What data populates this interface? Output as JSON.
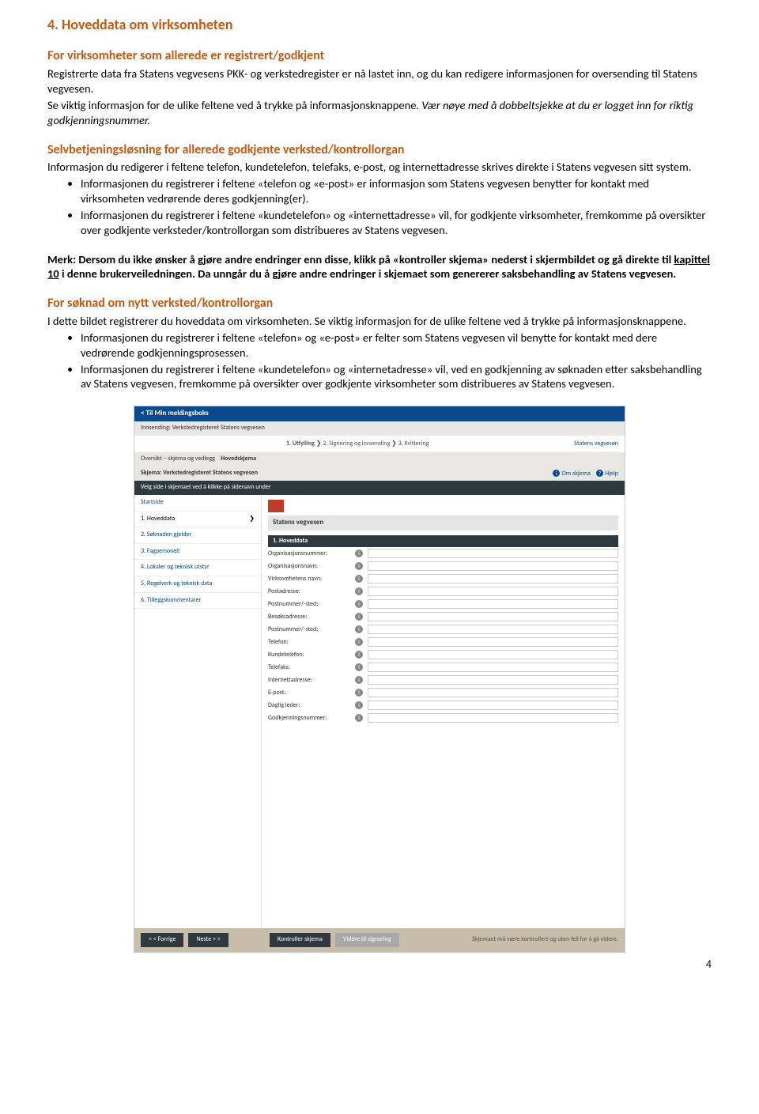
{
  "doc": {
    "h1": "4. Hoveddata om virksomheten",
    "s1": {
      "title": "For virksomheter som allerede er registrert/godkjent",
      "p1": "Registrerte data fra Statens vegvesens PKK- og verkstedregister er nå lastet inn, og du kan redigere informasjonen for oversending til Statens vegvesen.",
      "p2a": "Se viktig informasjon for de ulike feltene ved å trykke på informasjonsknappene. ",
      "p2b": "Vær nøye med å dobbeltsjekke at du er logget inn for riktig godkjenningsnummer."
    },
    "s2": {
      "title": "Selvbetjeningsløsning for allerede godkjente verksted/kontrollorgan",
      "p1": "Informasjon du redigerer i feltene telefon, kundetelefon, telefaks, e-post, og internettadresse skrives direkte i Statens vegvesen sitt system.",
      "b1": "Informasjonen du registrerer i feltene «telefon og «e-post» er informasjon som Statens vegvesen benytter for kontakt med virksomheten vedrørende deres godkjenning(er).",
      "b2": "Informasjonen du registrerer i feltene «kundetelefon» og «internettadresse» vil, for godkjente virksomheter, fremkomme på oversikter over godkjente verksteder/kontrollorgan som distribueres av Statens vegvesen."
    },
    "note": {
      "a": "Merk: Dersom du ikke ønsker å gjøre andre endringer enn disse, klikk på «kontroller skjema» nederst i skjermbildet og gå direkte til ",
      "link": "kapittel 10",
      "b": " i denne brukerveiledningen. Da unngår du å gjøre andre endringer i skjemaet som genererer saksbehandling av Statens vegvesen."
    },
    "s3": {
      "title": "For søknad om nytt verksted/kontrollorgan",
      "p1": "I dette bildet registrerer du hoveddata om virksomheten. Se viktig informasjon for de ulike feltene ved å trykke på informasjonsknappene.",
      "b1": "Informasjonen du registrerer i feltene «telefon» og «e-post» er felter som Statens vegvesen vil benytte for kontakt med dere vedrørende godkjenningsprosessen.",
      "b2": "Informasjonen du registrerer i feltene «kundetelefon» og «internetadresse» vil, ved en godkjenning av søknaden etter saksbehandling av Statens vegvesen, fremkomme på oversikter over godkjente virksomheter som distribueres av Statens vegvesen."
    },
    "page": "4"
  },
  "shot": {
    "backlink": "< Til Min meldingsboks",
    "innsending": "Innsending: Verkstedregisteret Statens vegvesen",
    "brand_right": "Statens vegvesen",
    "steps": {
      "s1": "1. Utfylling",
      "s2": "2. Signering og innsending",
      "s3": "3. Kvittering"
    },
    "tabs": {
      "oversikt": "Oversikt – skjema og vedlegg",
      "hoved": "Hovedskjema"
    },
    "skjema_label": "Skjema: Verkstedregisteret Statens vegvesen",
    "om_skjema": "Om skjema",
    "hjelp": "Hjelp",
    "help_hint": "Velg side i skjemaet ved å klikke på sidenavn under",
    "side": {
      "start": "Startside",
      "i1": "1. Hoveddata",
      "i2": "2. Søknaden gjelder",
      "i3": "3. Fagpersonell",
      "i4": "4. Lokaler og teknisk utstyr",
      "i5": "5. Regelverk og teknisk data",
      "i6": "6. Tilleggskommentarer"
    },
    "main_brand": "Statens vegvesen",
    "section_title": "1. Hoveddata",
    "fields": [
      "Organisasjonsnummer:",
      "Organisasjonsnavn:",
      "Virksomhetens navn:",
      "Postadresse:",
      "Postnummer/-sted:",
      "Besøksadresse:",
      "Postnummer/-sted:",
      "Telefon:",
      "Kundetelefon:",
      "Telefaks:",
      "Internettadresse:",
      "E-post:",
      "Daglig leder:",
      "Godkjenningsnummer:"
    ],
    "foot": {
      "prev": "< < Forrige",
      "next": "Neste > >",
      "kontroller": "Kontroller skjema",
      "send": "Videre til signering",
      "msg": "Skjemaet må være kontrollert og uten feil for å gå videre."
    }
  }
}
